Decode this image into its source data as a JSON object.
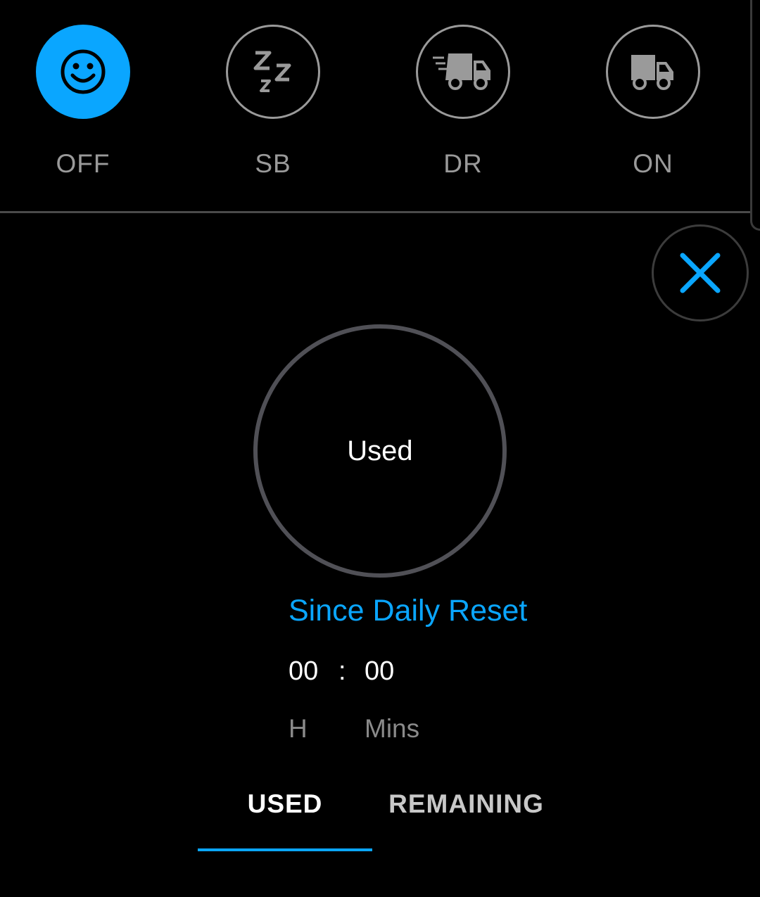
{
  "status_buttons": [
    {
      "id": "off",
      "label": "OFF",
      "icon": "smiley-face-icon",
      "active": true
    },
    {
      "id": "sb",
      "label": "SB",
      "icon": "sleep-zzz-icon",
      "active": false
    },
    {
      "id": "dr",
      "label": "DR",
      "icon": "truck-driving-icon",
      "active": false
    },
    {
      "id": "on",
      "label": "ON",
      "icon": "truck-icon",
      "active": false
    }
  ],
  "close_icon": "close-icon",
  "gauge": {
    "label": "Used"
  },
  "period": {
    "title": "Since Daily Reset"
  },
  "time": {
    "hours": "00",
    "separator": ":",
    "minutes": "00",
    "hours_unit": "H",
    "minutes_unit": "Mins"
  },
  "tabs": {
    "used": "USED",
    "remaining": "REMAINING",
    "selected": "used"
  },
  "colors": {
    "accent": "#0aa6ff",
    "background": "#000000",
    "inactive_text": "#9a9a9a",
    "gauge_ring": "#505056"
  }
}
